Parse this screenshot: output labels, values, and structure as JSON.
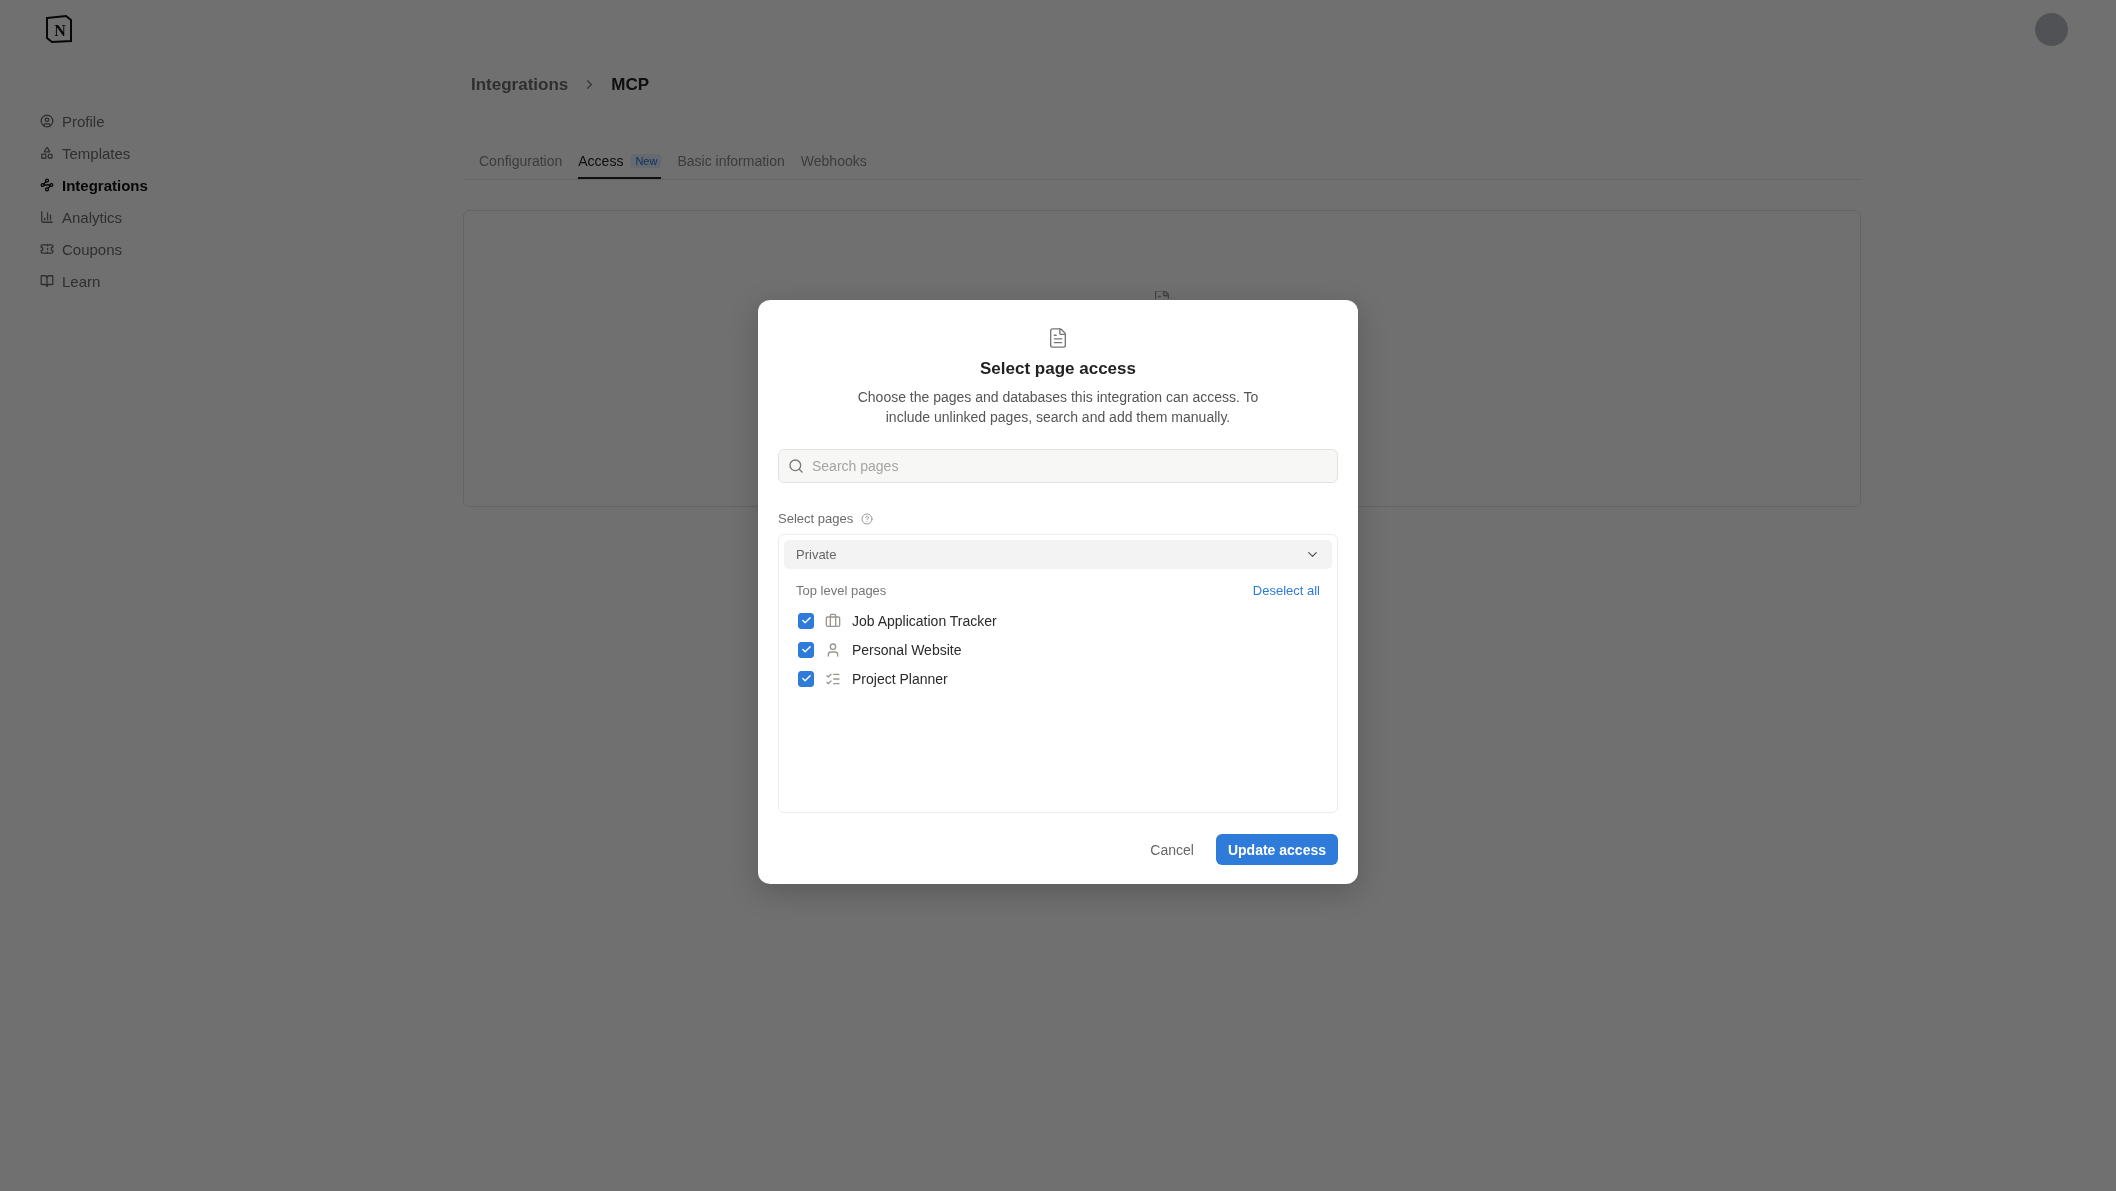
{
  "app_logo": {
    "letter": "N"
  },
  "sidebar": {
    "items": [
      {
        "label": "Profile",
        "selected": false
      },
      {
        "label": "Templates",
        "selected": false
      },
      {
        "label": "Integrations",
        "selected": true
      },
      {
        "label": "Analytics",
        "selected": false
      },
      {
        "label": "Coupons",
        "selected": false
      },
      {
        "label": "Learn",
        "selected": false
      }
    ]
  },
  "breadcrumb": {
    "parent": "Integrations",
    "current": "MCP"
  },
  "tabs": [
    {
      "label": "Configuration",
      "selected": false
    },
    {
      "label": "Access",
      "badge": "New",
      "selected": true
    },
    {
      "label": "Basic information",
      "selected": false
    },
    {
      "label": "Webhooks",
      "selected": false
    }
  ],
  "dialog": {
    "title": "Select page access",
    "description": "Choose the pages and databases this integration can access. To include unlinked pages, search and add them manually.",
    "search": {
      "placeholder": "Search pages"
    },
    "section_label": "Select pages",
    "workspace_select": {
      "value": "Private"
    },
    "list_heading": "Top level pages",
    "deselect_all": "Deselect all",
    "pages": [
      {
        "title": "Job Application Tracker",
        "kind": "briefcase",
        "checked": true
      },
      {
        "title": "Personal Website",
        "kind": "person",
        "checked": true
      },
      {
        "title": "Project Planner",
        "kind": "checklist",
        "checked": true
      }
    ],
    "buttons": {
      "cancel": "Cancel",
      "confirm": "Update access"
    }
  }
}
